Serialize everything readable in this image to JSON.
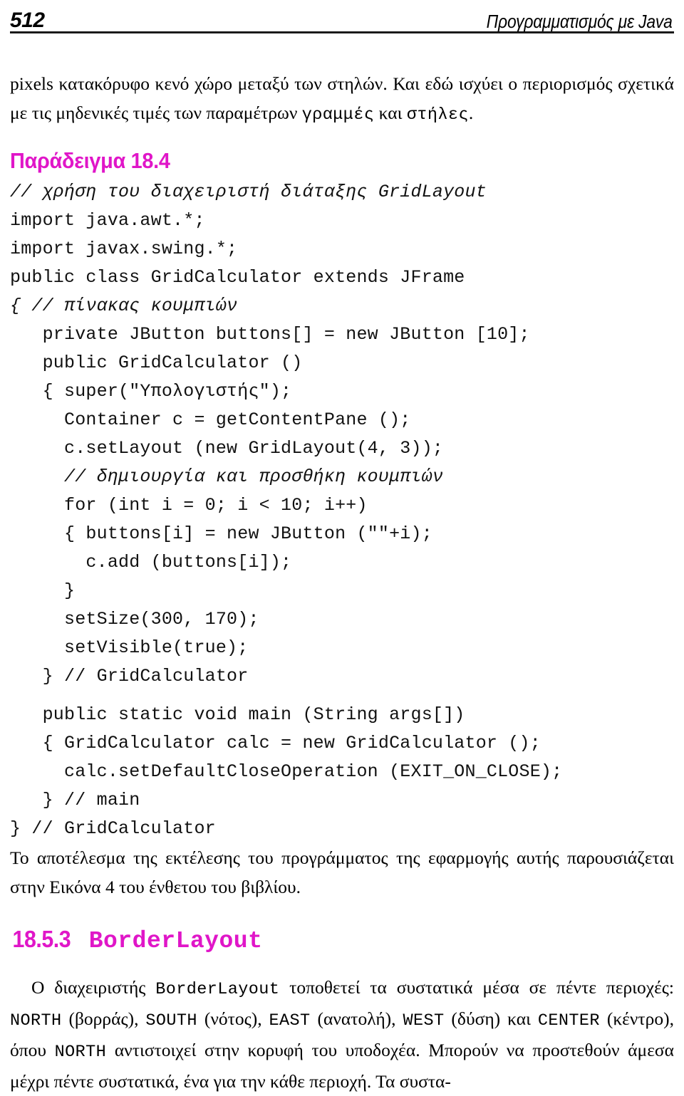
{
  "header": {
    "folio": "512",
    "running_title": "Προγραμματισμός με Java"
  },
  "intro_paragraph": {
    "part1": "pixels κατακόρυφο κενό χώρο μεταξύ των στηλών. Και εδώ ισχύει ο περιορισμός σχετικά με τις μηδενικές τιμές των παραμέτρων ",
    "code1": "γραμμές",
    "part2": " και ",
    "code2": "στήλες",
    "part3": "."
  },
  "example": {
    "heading": "Παράδειγμα 18.4",
    "code_lines": [
      "// χρήση του διαχειριστή διάταξης GridLayout",
      "import java.awt.*;",
      "import javax.swing.*;",
      "public class GridCalculator extends JFrame",
      "{ // πίνακας κουμπιών",
      "   private JButton buttons[] = new JButton [10];",
      "   public GridCalculator ()",
      "   { super(\"Υπολογιστής\");",
      "     Container c = getContentPane ();",
      "     c.setLayout (new GridLayout(4, 3));",
      "     // δημιουργία και προσθήκη κουμπιών",
      "     for (int i = 0; i < 10; i++)",
      "     { buttons[i] = new JButton (\"\"+i);",
      "       c.add (buttons[i]);",
      "     }",
      "     setSize(300, 170);",
      "     setVisible(true);",
      "   } // GridCalculator",
      "",
      "   public static void main (String args[])",
      "   { GridCalculator calc = new GridCalculator ();",
      "     calc.setDefaultCloseOperation (EXIT_ON_CLOSE);",
      "   } // main",
      "} // GridCalculator"
    ],
    "code_line_styles": [
      "comment",
      "plain",
      "plain",
      "plain",
      "comment",
      "plain",
      "plain",
      "plain",
      "plain",
      "plain",
      "comment",
      "plain",
      "plain",
      "plain",
      "plain",
      "plain",
      "plain",
      "plain",
      "blank",
      "plain",
      "plain",
      "plain",
      "plain",
      "plain"
    ]
  },
  "result_paragraph": {
    "text": "Το αποτέλεσμα της εκτέλεσης του προγράμματος της εφαρμογής αυτής παρουσιάζεται στην Εικόνα 4 του ένθετου του βιβλίου."
  },
  "section": {
    "number": "18.5.3",
    "name": "BorderLayout"
  },
  "border_paragraph": {
    "p1": "Ο διαχειριστής ",
    "c1": "BorderLayout",
    "p2": " τοποθετεί τα συστατικά μέσα σε πέντε περιοχές: ",
    "c2": "NORTH",
    "p3": " (βορράς), ",
    "c3": "SOUTH",
    "p4": " (νότος), ",
    "c4": "EAST",
    "p5": " (ανατολή), ",
    "c5": "WEST",
    "p6": " (δύση) και ",
    "c6": "CENTER",
    "p7": " (κέντρο), όπου ",
    "c7": "NORTH",
    "p8": " αντιστοιχεί στην κορυφή του υποδοχέα. Μπορούν να προστεθούν άμεσα μέχρι πέντε συστατικά, ένα για την κάθε περιοχή. Τα συστα-"
  },
  "colors": {
    "magenta": "#e016c8",
    "text": "#000000",
    "rule": "#1a1a1a"
  }
}
